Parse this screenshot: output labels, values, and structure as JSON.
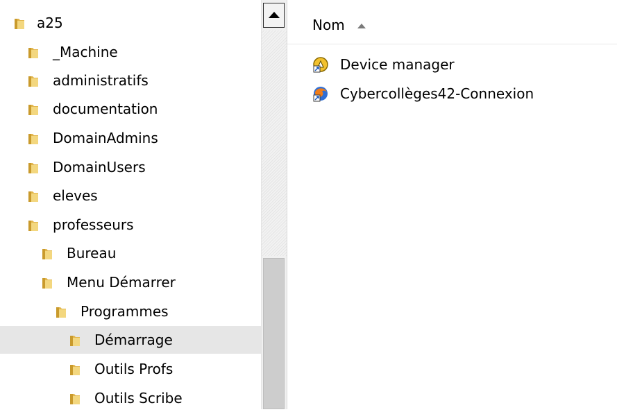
{
  "tree": {
    "items": [
      {
        "label": "a25",
        "depth": 0
      },
      {
        "label": "_Machine",
        "depth": 1
      },
      {
        "label": "administratifs",
        "depth": 1
      },
      {
        "label": "documentation",
        "depth": 1
      },
      {
        "label": "DomainAdmins",
        "depth": 1
      },
      {
        "label": "DomainUsers",
        "depth": 1
      },
      {
        "label": "eleves",
        "depth": 1
      },
      {
        "label": "professeurs",
        "depth": 1
      },
      {
        "label": "Bureau",
        "depth": 2
      },
      {
        "label": "Menu Démarrer",
        "depth": 2
      },
      {
        "label": "Programmes",
        "depth": 3
      },
      {
        "label": "Démarrage",
        "depth": 4,
        "selected": true
      },
      {
        "label": "Outils Profs",
        "depth": 4
      },
      {
        "label": "Outils Scribe",
        "depth": 4
      }
    ]
  },
  "content": {
    "column_header": "Nom",
    "sort_icon": "sort-ascending-icon",
    "files": [
      {
        "label": "Device manager",
        "icon": "shortcut-app-icon"
      },
      {
        "label": "Cybercollèges42-Connexion",
        "icon": "shortcut-firefox-icon"
      }
    ]
  },
  "colors": {
    "selected_bg": "#e6e6e6",
    "folder": "#e8c35a"
  }
}
